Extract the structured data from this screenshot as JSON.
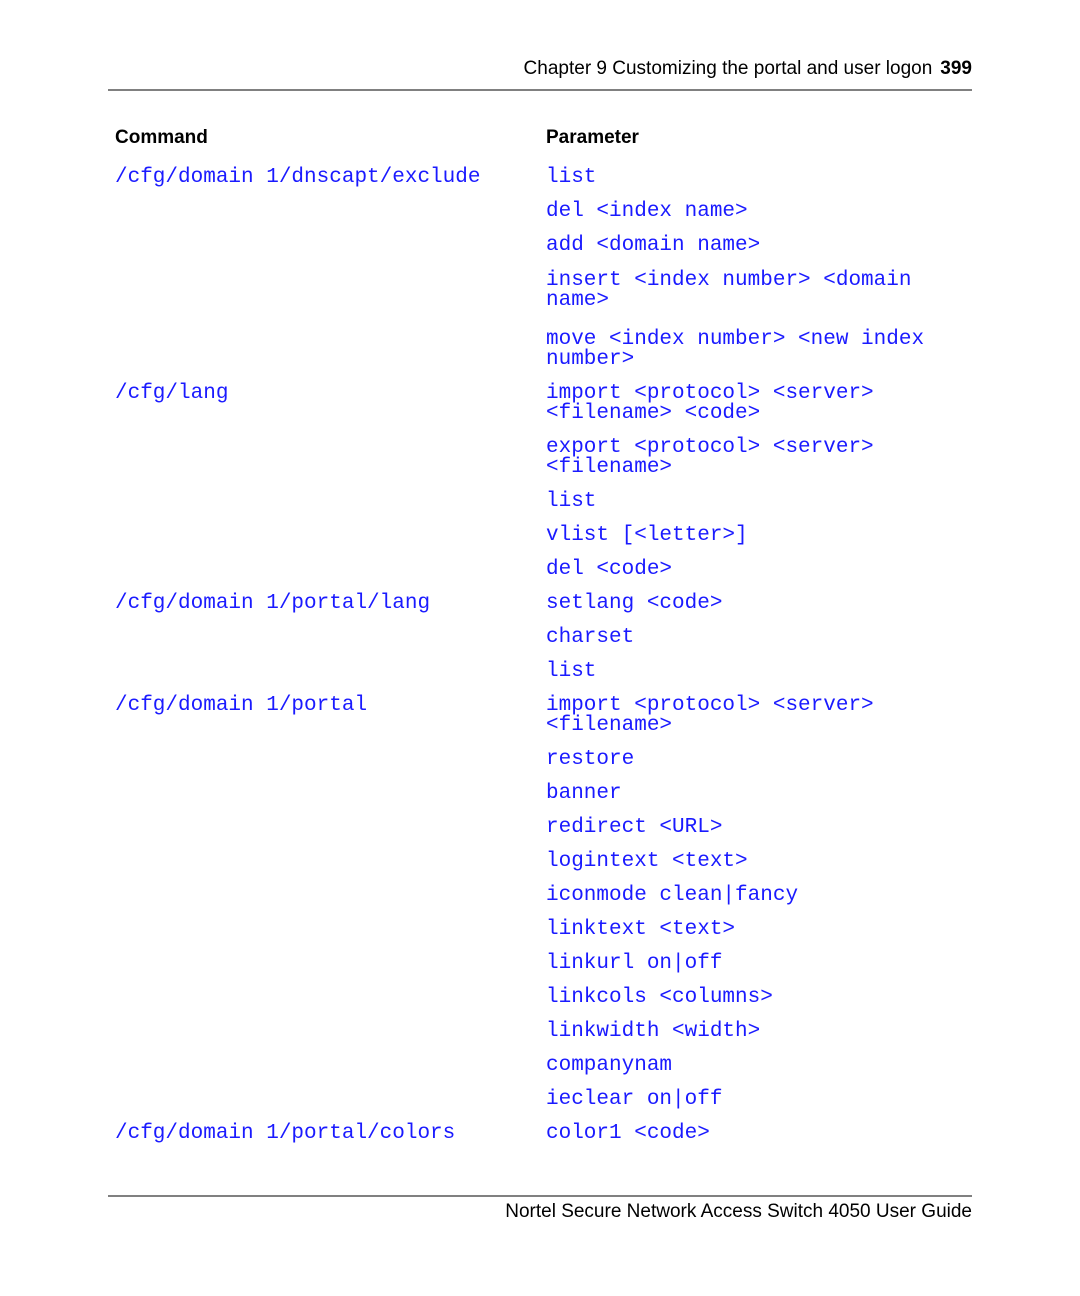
{
  "header": {
    "chapter_title": "Chapter 9  Customizing the portal and user logon",
    "page_number": "399"
  },
  "table": {
    "columns": [
      "Command",
      "Parameter"
    ],
    "commands": [
      {
        "text": "/cfg/domain 1/dnscapt/exclude"
      },
      {
        "text": "/cfg/lang"
      },
      {
        "text": "/cfg/domain 1/portal/lang"
      },
      {
        "text": "/cfg/domain 1/portal"
      },
      {
        "text": "/cfg/domain 1/portal/colors"
      }
    ],
    "parameters": [
      "list",
      "del <index name>",
      "add <domain name>",
      "insert <index number> <domain\nname>",
      "move <index number> <new index\nnumber>",
      "import <protocol> <server>\n<filename> <code>",
      "export <protocol> <server>\n<filename>",
      "list",
      "vlist [<letter>]",
      "del <code>",
      "setlang <code>",
      "charset",
      "list",
      "import <protocol> <server>\n<filename>",
      "restore",
      "banner",
      "redirect <URL>",
      "logintext <text>",
      "iconmode clean|fancy",
      "linktext <text>",
      "linkurl on|off",
      "linkcols <columns>",
      "linkwidth <width>",
      "companynam",
      "ieclear on|off",
      "color1 <code>"
    ]
  },
  "footer": {
    "guide_title": "Nortel Secure Network Access Switch 4050 User Guide"
  },
  "colors": {
    "code_text": "#1a1aff",
    "rule": "#808080"
  }
}
